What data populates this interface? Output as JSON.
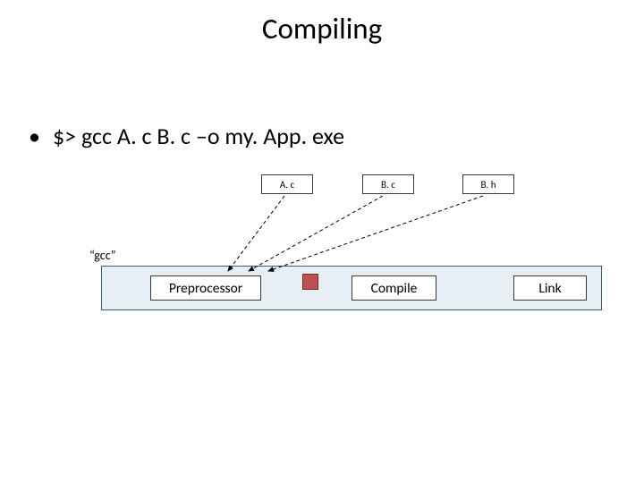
{
  "title": "Compiling",
  "bullet": "$> gcc A. c B. c –o my. App. exe",
  "files": {
    "ac": "A. c",
    "bc": "B. c",
    "bh": "B. h"
  },
  "gcc_label": "“gcc”",
  "stages": {
    "pre": "Preprocessor",
    "compile": "Compile",
    "link": "Link"
  }
}
